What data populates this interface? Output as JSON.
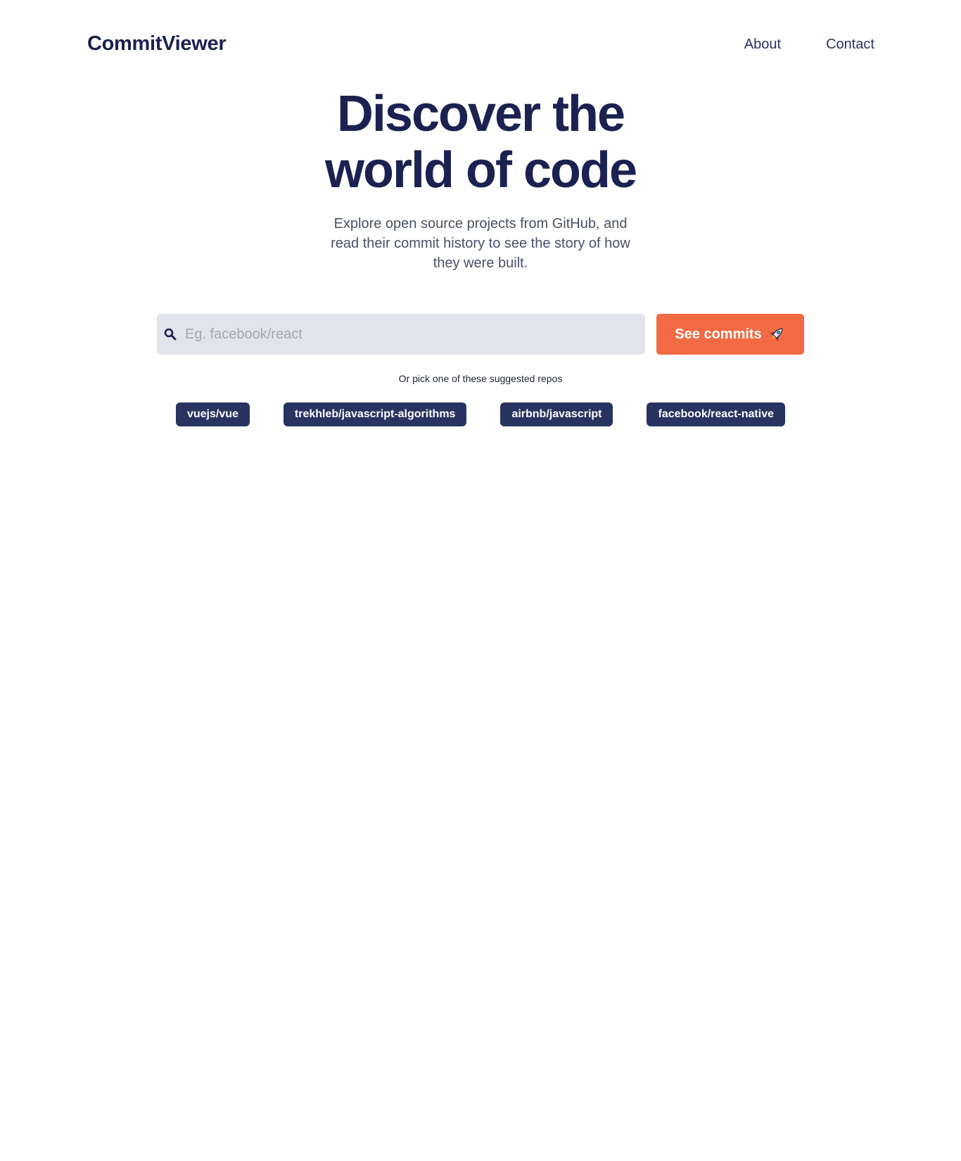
{
  "header": {
    "logo": "CommitViewer",
    "nav": [
      {
        "label": "About"
      },
      {
        "label": "Contact"
      }
    ]
  },
  "hero": {
    "title": "Discover the world of code",
    "subtitle": "Explore open source projects from GitHub, and read their commit history to see the story of how they were built."
  },
  "search": {
    "placeholder": "Eg. facebook/react",
    "value": "",
    "icon": "search-icon",
    "button_label": "See commits",
    "button_icon": "rocket-icon"
  },
  "suggestions": {
    "label": "Or pick one of these suggested repos",
    "repos": [
      "vuejs/vue",
      "trekhleb/javascript-algorithms",
      "airbnb/javascript",
      "facebook/react-native"
    ]
  },
  "colors": {
    "primary_text": "#1b2150",
    "accent": "#f26a44",
    "chip_bg": "#283360",
    "input_bg": "#e1e5eb"
  }
}
